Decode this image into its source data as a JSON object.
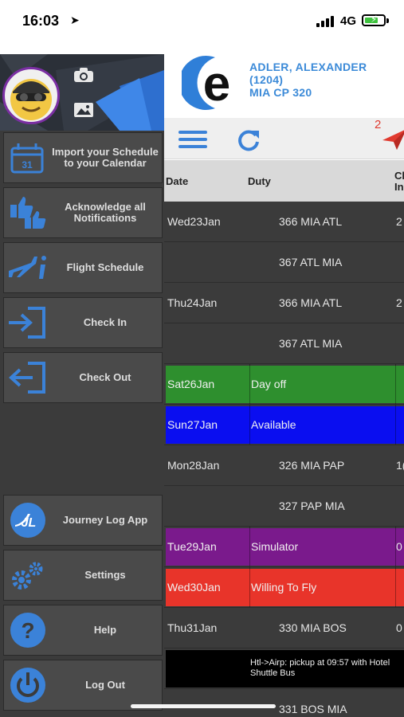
{
  "status": {
    "time": "16:03",
    "network": "4G"
  },
  "drawer": {
    "menu": [
      {
        "name": "import-schedule",
        "label": "Import your Schedule to your Calendar",
        "icon": "calendar-icon"
      },
      {
        "name": "acknowledge-notifications",
        "label": "Acknowledge all Notifications",
        "icon": "thumbs-up-icon"
      },
      {
        "name": "flight-schedule",
        "label": "Flight Schedule",
        "icon": "plane-info-icon"
      },
      {
        "name": "check-in",
        "label": "Check In",
        "icon": "sign-in-icon"
      },
      {
        "name": "check-out",
        "label": "Check Out",
        "icon": "sign-out-icon"
      },
      {
        "name": "journey-log",
        "label": "Journey Log App",
        "icon": "journey-log-icon"
      },
      {
        "name": "settings",
        "label": "Settings",
        "icon": "gears-icon"
      },
      {
        "name": "help",
        "label": "Help",
        "icon": "question-icon"
      },
      {
        "name": "log-out",
        "label": "Log Out",
        "icon": "power-icon"
      }
    ]
  },
  "profile": {
    "name": "ADLER, ALEXANDER",
    "id": "(1204)",
    "base": "MIA CP 320"
  },
  "toolbar": {
    "notification_count": "2"
  },
  "table": {
    "headers": {
      "date": "Date",
      "duty": "Duty",
      "checkin_1": "Cl",
      "checkin_2": "In"
    },
    "rows": [
      {
        "date": "Wed23Jan",
        "duty": "366 MIA ATL",
        "ci": "2",
        "bg": ""
      },
      {
        "date": "",
        "duty": "367 ATL MIA",
        "ci": "",
        "bg": ""
      },
      {
        "date": "Thu24Jan",
        "duty": "366 MIA ATL",
        "ci": "2",
        "bg": ""
      },
      {
        "date": "",
        "duty": "367 ATL MIA",
        "ci": "",
        "bg": ""
      },
      {
        "date": "Sat26Jan",
        "duty": "Day off",
        "ci": "",
        "bg": "#2e8f2e"
      },
      {
        "date": "Sun27Jan",
        "duty": "Available",
        "ci": "",
        "bg": "#0a0ef0"
      },
      {
        "date": "Mon28Jan",
        "duty": "326 MIA PAP",
        "ci": "1(",
        "bg": ""
      },
      {
        "date": "",
        "duty": "327 PAP MIA",
        "ci": "",
        "bg": ""
      },
      {
        "date": "Tue29Jan",
        "duty": "Simulator",
        "ci": "0",
        "bg": "#7a1a8c"
      },
      {
        "date": "Wed30Jan",
        "duty": "Willing To Fly",
        "ci": "",
        "bg": "#e8342a"
      },
      {
        "date": "Thu31Jan",
        "duty": "330 MIA BOS",
        "ci": "0",
        "bg": ""
      },
      {
        "date": "",
        "duty": "Htl->Airp: pickup at 09:57 with Hotel Shuttle Bus",
        "ci": "",
        "bg": "#000000",
        "note": true
      },
      {
        "date": "",
        "duty": "331 BOS MIA",
        "ci": "",
        "bg": ""
      }
    ]
  },
  "colors": {
    "accent": "#3b82d8",
    "drawer": "#3b3b3b",
    "button": "#4a4a4a",
    "alert": "#e03a2f"
  }
}
